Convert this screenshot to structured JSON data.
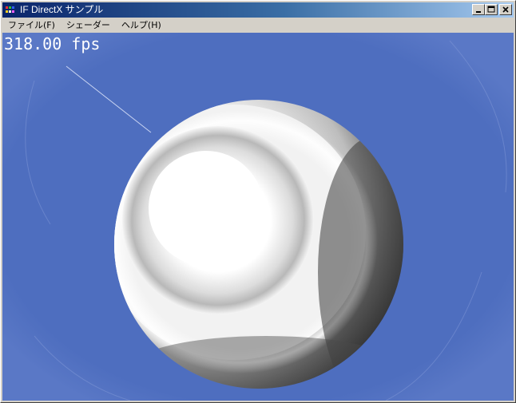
{
  "window": {
    "title": "IF DirectX サンプル",
    "controls": {
      "minimize": "minimize-icon",
      "maximize": "maximize-icon",
      "close": "close-icon"
    }
  },
  "menubar": {
    "items": [
      {
        "label": "ファイル(F)"
      },
      {
        "label": "シェーダー"
      },
      {
        "label": "ヘルプ(H)"
      }
    ]
  },
  "viewport": {
    "fps_text": "318.00 fps",
    "background_color": "#4e6ebf",
    "object": "sphere"
  },
  "colors": {
    "title_start": "#0a246a",
    "title_end": "#a6caf0",
    "face": "#d4d0c8",
    "viewport_bg": "#4e6ebf"
  }
}
